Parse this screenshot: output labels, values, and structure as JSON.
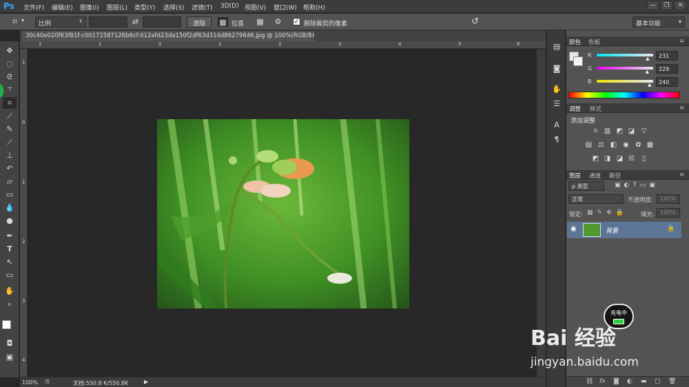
{
  "app": {
    "logo": "Ps"
  },
  "menu": [
    "文件(F)",
    "编辑(E)",
    "图像(I)",
    "图层(L)",
    "类型(Y)",
    "选择(S)",
    "滤镜(T)",
    "3D(D)",
    "视图(V)",
    "窗口(W)",
    "帮助(H)"
  ],
  "window_controls": [
    "—",
    "❐",
    "✕"
  ],
  "options": {
    "ratio_label": "比例",
    "clear_button": "清除",
    "straighten_label": "拉直",
    "delete_cropped_label": "删除裁剪的像素",
    "delete_cropped_checked": true,
    "workspace": "基本功能"
  },
  "document": {
    "tab_title": "30c40e020f63f81f-c00171587126b6cf-012afd23da150f2df63d314d86279646.jpg @ 100%(RGB/8#) *",
    "zoom": "100%",
    "doc_info": "文档:550.8 K/550.8K"
  },
  "rulers": {
    "top": [
      "2",
      "1",
      "0",
      "1",
      "2",
      "3",
      "4",
      "5",
      "6"
    ],
    "left": [
      "1",
      "0",
      "1",
      "2",
      "3",
      "4"
    ]
  },
  "color_panel": {
    "tabs": [
      "颜色",
      "色板"
    ],
    "channels": [
      {
        "label": "R",
        "value": "231",
        "fraction": 0.906
      },
      {
        "label": "G",
        "value": "229",
        "fraction": 0.898
      },
      {
        "label": "B",
        "value": "240",
        "fraction": 0.941
      }
    ],
    "foreground": "#e7e5f0"
  },
  "adjustments_panel": {
    "tabs": [
      "调整",
      "样式"
    ],
    "title": "添加调整"
  },
  "layers_panel": {
    "tabs": [
      "图层",
      "通道",
      "路径"
    ],
    "kind_filter": "ρ 类型",
    "blend_mode": "正常",
    "opacity_label": "不透明度:",
    "opacity_value": "100%",
    "lock_label": "锁定:",
    "fill_label": "填充:",
    "fill_value": "100%",
    "layer_name": "背景"
  },
  "overlays": {
    "charging": "充电中",
    "watermark_brand": "Bai 经验",
    "watermark_url": "jingyan.baidu.com"
  }
}
